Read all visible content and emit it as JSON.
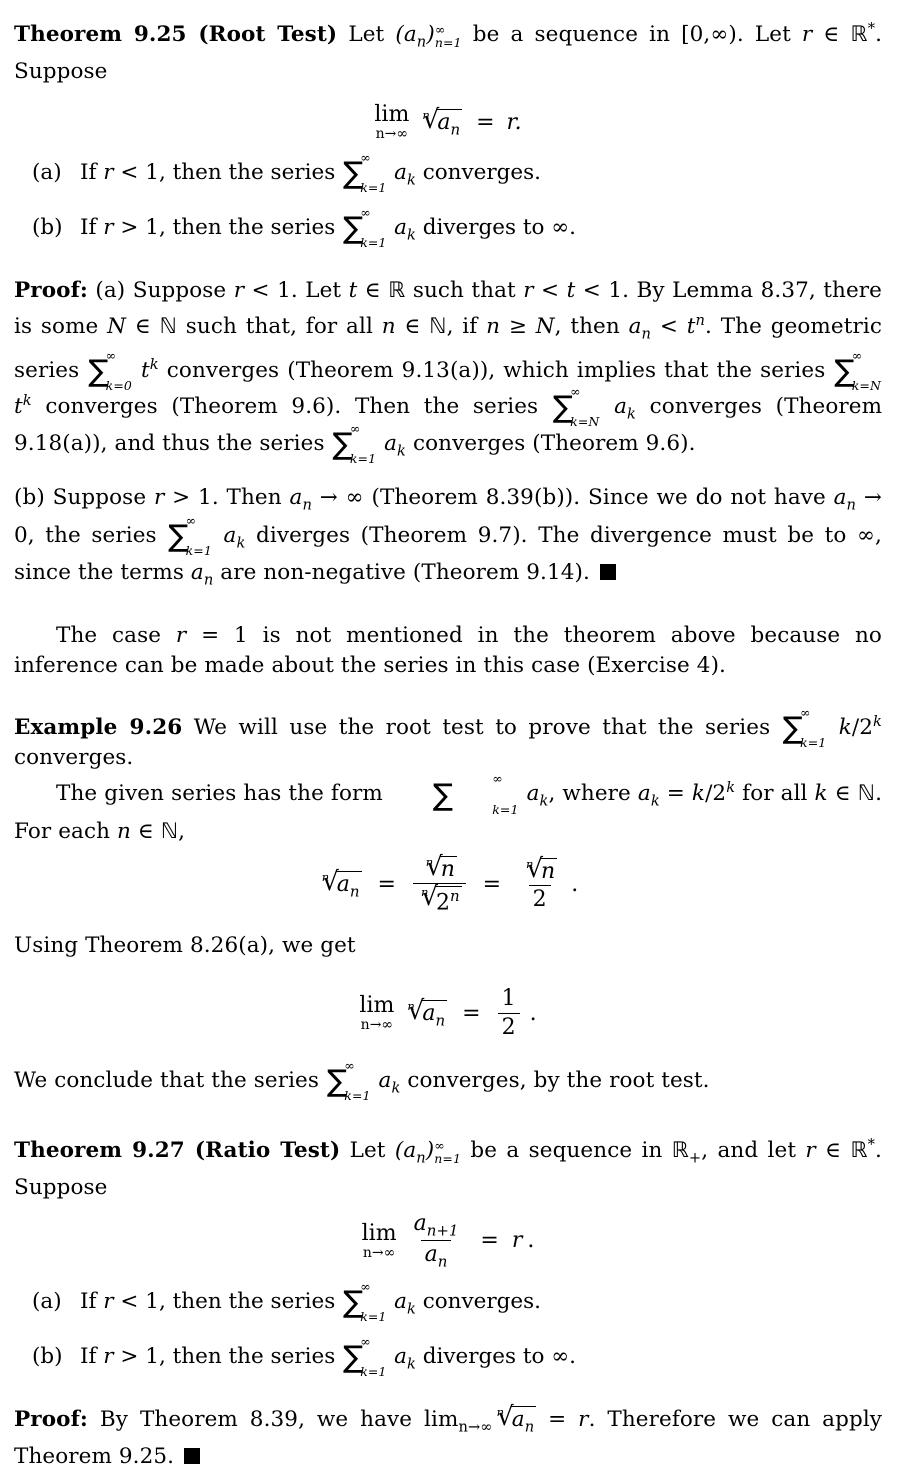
{
  "document": {
    "type": "mathematical-textbook-page",
    "background_color": "#ffffff",
    "text_color": "#000000"
  },
  "theorem_root_test": {
    "heading": "Theorem 9.25 (Root Test)",
    "statement_part1": "Let",
    "sequence": "(a",
    "sequence_sub": "n",
    "sequence_close": ")",
    "seq_sup": "∞",
    "seq_sub": "n=1",
    "statement_part2": "be a sequence in [0,∞). Let",
    "r_var": "r",
    "in_sym": "∈",
    "rstar": "ℝ",
    "rstar_sup": "*",
    "statement_part3": "Suppose",
    "display_eq": {
      "lim_op": "lim",
      "lim_sub": "n→∞",
      "root_index": "n",
      "radicand_base": "a",
      "radicand_sub": "n",
      "equals": "=",
      "rhs": "r."
    },
    "items": [
      {
        "label": "(a)",
        "pre": "If",
        "var": "r",
        "rel": "< 1, then the series",
        "sum_upper": "∞",
        "sum_lower": "k=1",
        "term_base": "a",
        "term_sub": "k",
        "post": "converges."
      },
      {
        "label": "(b)",
        "pre": "If",
        "var": "r",
        "rel": "> 1, then the series",
        "sum_upper": "∞",
        "sum_lower": "k=1",
        "term_base": "a",
        "term_sub": "k",
        "post": "diverges to ∞."
      }
    ]
  },
  "proof_root_test": {
    "heading": "Proof:",
    "part_a": {
      "s1": "(a) Suppose",
      "r1": "r",
      "s2": "< 1. Let",
      "t1": "t",
      "s3": "∈",
      "R1": "ℝ",
      "s4": "such that",
      "r2": "r",
      "s5": "<",
      "t2": "t",
      "s6": "< 1. By Lemma 8.37, there is some",
      "N1": "N",
      "s7": "∈",
      "N2": "ℕ",
      "s8": "such that, for all",
      "n1": "n",
      "s9": "∈",
      "N3": "ℕ",
      "s10": ", if",
      "n2": "n",
      "s11": "≥",
      "N4": "N",
      "s12": ", then",
      "a1": "a",
      "a1sub": "n",
      "s13": "<",
      "t3": "t",
      "t3sup": "n",
      "s14": ". The geometric series",
      "sum1_upper": "∞",
      "sum1_lower": "k=0",
      "term1": "t",
      "term1sup": "k",
      "s15": "converges (Theorem 9.13(a)), which implies that the series",
      "sum2_upper": "∞",
      "sum2_lower": "k=N",
      "term2": "t",
      "term2sup": "k",
      "s16": "converges (Theorem 9.6). Then the series",
      "sum3_upper": "∞",
      "sum3_lower": "k=N",
      "term3": "a",
      "term3sub": "k",
      "s17": "converges (Theorem 9.18(a)), and thus the series",
      "sum4_upper": "∞",
      "sum4_lower": "k=1",
      "term4": "a",
      "term4sub": "k",
      "s18": "converges (Theorem 9.6)."
    },
    "part_b": {
      "s1": "(b) Suppose",
      "r1": "r",
      "s2": "> 1. Then",
      "a1": "a",
      "a1sub": "n",
      "s3": "→ ∞ (Theorem 8.39(b)). Since we do not have",
      "a2": "a",
      "a2sub": "n",
      "s4": "→ 0, the series",
      "sum_upper": "∞",
      "sum_lower": "k=1",
      "term": "a",
      "term_sub": "k",
      "s5": "diverges (Theorem 9.7). The divergence must be to ∞, since the terms",
      "a3": "a",
      "a3sub": "n",
      "s6": "are non-negative (Theorem 9.14)."
    }
  },
  "remark": {
    "s1": "The case",
    "r": "r",
    "s2": "= 1 is not mentioned in the theorem above because no inference can be made about the series in this case (Exercise 4)."
  },
  "example": {
    "heading": "Example 9.26",
    "s1": "We will use the root test to prove that the series",
    "sum_upper": "∞",
    "sum_lower": "k=1",
    "term_num": "k",
    "term_slash": "/2",
    "term_sup": "k",
    "s2": "converges.",
    "s3": "The given series has the form",
    "sum2_upper": "∞",
    "sum2_lower": "k=1",
    "term2": "a",
    "term2sub": "k",
    "s4": ", where",
    "ak": "a",
    "aksub": "k",
    "s5": "=",
    "kval": "k",
    "kval2": "/2",
    "kval_sup": "k",
    "s6": "for all",
    "k2": "k",
    "s7": "∈",
    "N": "ℕ",
    "s8": ". For each",
    "n": "n",
    "s9": "∈",
    "N2": "ℕ",
    "s10": ",",
    "display_eq": {
      "root_index": "n",
      "lhs_base": "a",
      "lhs_sub": "n",
      "eq1": "=",
      "num_idx": "n",
      "num_base": "n",
      "den_idx": "n",
      "den_base": "2",
      "den_sup": "n",
      "eq2": "=",
      "rhs_idx": "n",
      "rhs_base": "n",
      "rhs_den": "2",
      "period": "."
    },
    "s11": "Using Theorem 8.26(a), we get",
    "display_eq2": {
      "lim_op": "lim",
      "lim_sub": "n→∞",
      "root_index": "n",
      "radicand_base": "a",
      "radicand_sub": "n",
      "equals": "=",
      "frac_num": "1",
      "frac_den": "2",
      "period": "."
    },
    "s12": "We conclude that the series",
    "sum3_upper": "∞",
    "sum3_lower": "k=1",
    "term3": "a",
    "term3sub": "k",
    "s13": "converges, by the root test."
  },
  "theorem_ratio_test": {
    "heading": "Theorem 9.27 (Ratio Test)",
    "statement_part1": "Let",
    "sequence": "(a",
    "sequence_sub": "n",
    "sequence_close": ")",
    "seq_sup": "∞",
    "seq_sub": "n=1",
    "statement_part2": "be a sequence in",
    "Rplus": "ℝ",
    "Rplus_sub": "+",
    "statement_part3": ", and let",
    "r_var": "r",
    "in_sym": "∈",
    "rstar": "ℝ",
    "rstar_sup": "*",
    "statement_part4": "Suppose",
    "display_eq": {
      "lim_op": "lim",
      "lim_sub": "n→∞",
      "num_base": "a",
      "num_sub": "n+1",
      "den_base": "a",
      "den_sub": "n",
      "equals": "=",
      "rhs": "r",
      "period": "."
    },
    "items": [
      {
        "label": "(a)",
        "pre": "If",
        "var": "r",
        "rel": "< 1, then the series",
        "sum_upper": "∞",
        "sum_lower": "k=1",
        "term_base": "a",
        "term_sub": "k",
        "post": "converges."
      },
      {
        "label": "(b)",
        "pre": "If",
        "var": "r",
        "rel": "> 1, then the series",
        "sum_upper": "∞",
        "sum_lower": "k=1",
        "term_base": "a",
        "term_sub": "k",
        "post": "diverges to ∞."
      }
    ]
  },
  "proof_ratio_test": {
    "heading": "Proof:",
    "s1": "By Theorem 8.39, we have",
    "lim_op": "lim",
    "lim_sub": "n→∞",
    "root_index": "n",
    "radicand_base": "a",
    "radicand_sub": "n",
    "s2": "=",
    "r": "r",
    "s3": ". Therefore we can apply Theorem 9.25."
  }
}
